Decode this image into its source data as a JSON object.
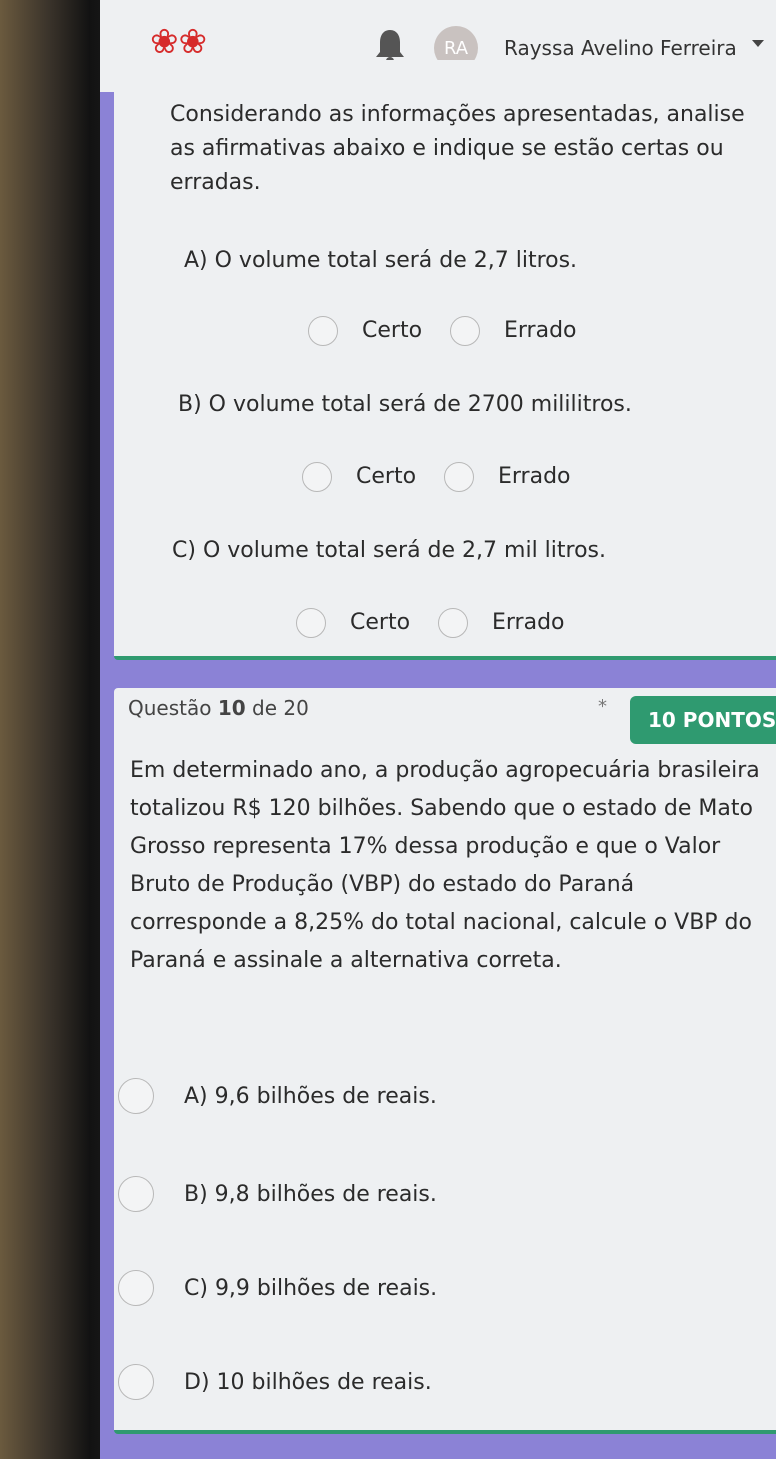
{
  "header": {
    "avatar_initials": "RA",
    "user_name": "Rayssa Avelino Ferreira"
  },
  "question9": {
    "intro": "Considerando as informações apresentadas, analise as afirmativas abaixo e indique se estão certas ou erradas.",
    "statements": [
      {
        "text": "A) O volume total será de 2,7 litros.",
        "option_true": "Certo",
        "option_false": "Errado"
      },
      {
        "text": "B) O volume total será de 2700 mililitros.",
        "option_true": "Certo",
        "option_false": "Errado"
      },
      {
        "text": "C) O volume total será de 2,7 mil litros.",
        "option_true": "Certo",
        "option_false": "Errado"
      }
    ]
  },
  "question10": {
    "label_prefix": "Questão",
    "number": "10",
    "label_suffix": "de 20",
    "required_mark": "*",
    "points": "10 PONTOS",
    "text": "Em determinado ano, a produção agropecuária brasileira totalizou R$ 120 bilhões. Sabendo que o estado de Mato Grosso representa 17% dessa produção e que o Valor Bruto de Produção (VBP) do estado do Paraná corresponde a 8,25% do total nacional, calcule o VBP do Paraná e assinale a alternativa correta.",
    "alternatives": [
      "A) 9,6 bilhões de reais.",
      "B) 9,8 bilhões de reais.",
      "C) 9,9 bilhões de reais.",
      "D) 10 bilhões de reais."
    ]
  },
  "colors": {
    "accent": "#2f9a70",
    "background": "#8b82d6",
    "card": "#eef0f2",
    "logo": "#d62b2b"
  }
}
